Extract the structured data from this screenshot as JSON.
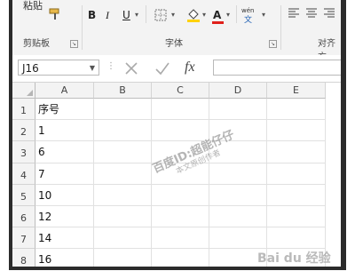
{
  "ribbon": {
    "paste_label": "粘贴",
    "clipboard_group": "剪贴板",
    "font_group": "字体",
    "align_group": "对齐方",
    "bold": "B",
    "italic": "I",
    "underline": "U",
    "font_color_glyph": "A",
    "phonetic_top": "wén",
    "phonetic_bottom": "文"
  },
  "formula_bar": {
    "name_box": "J16",
    "fx": "fx",
    "value": ""
  },
  "columns": [
    "A",
    "B",
    "C",
    "D",
    "E"
  ],
  "rows": [
    {
      "num": "1",
      "a": "序号"
    },
    {
      "num": "2",
      "a": "1"
    },
    {
      "num": "3",
      "a": "6"
    },
    {
      "num": "4",
      "a": "7"
    },
    {
      "num": "5",
      "a": "10"
    },
    {
      "num": "6",
      "a": "12"
    },
    {
      "num": "7",
      "a": "14"
    },
    {
      "num": "8",
      "a": "16"
    }
  ],
  "watermark": {
    "line1": "百度ID:超能仔仔",
    "line2": "本文原创作者",
    "corner": "Bai du 经验"
  },
  "colors": {
    "highlight": "#ffd200",
    "font_color": "#e0201b"
  }
}
